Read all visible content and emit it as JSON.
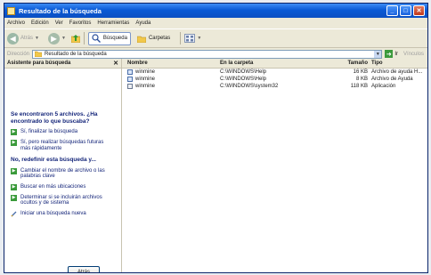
{
  "window": {
    "title": "Resultado de la búsqueda",
    "minimize": "_",
    "maximize": "□"
  },
  "menu": [
    "Archivo",
    "Edición",
    "Ver",
    "Favoritos",
    "Herramientas",
    "Ayuda"
  ],
  "toolbar": {
    "back_label": "Atrás",
    "search_label": "Búsqueda",
    "folders_label": "Carpetas"
  },
  "address": {
    "label": "Dirección",
    "value": "Resultado de la búsqueda",
    "go_label": "Ir",
    "links_label": "Vínculos"
  },
  "sidebar": {
    "title": "Asistente para búsqueda",
    "found_text": "Se encontraron 5 archivos. ¿Ha encontrado lo que buscaba?",
    "options_found": [
      "Sí, finalizar la búsqueda",
      "Sí, pero realizar búsquedas futuras más rápidamente"
    ],
    "redefine_text": "No, redefinir esta búsqueda y...",
    "options_redefine": [
      "Cambiar el nombre de archivo o las palabras clave",
      "Buscar en más ubicaciones",
      "Determinar si se incluirán archivos ocultos y de sistema"
    ],
    "new_search": "Iniciar una búsqueda nueva",
    "back_button": "Atrás"
  },
  "results": {
    "columns": {
      "name": "Nombre",
      "folder": "En la carpeta",
      "size": "Tamaño",
      "type": "Tipo"
    },
    "rows": [
      {
        "name": "winmine",
        "folder": "C:\\WINDOWS\\Help",
        "size": "16 KB",
        "type": "Archivo de ayuda H..."
      },
      {
        "name": "winmine",
        "folder": "C:\\WINDOWS\\Help",
        "size": "8 KB",
        "type": "Archivo de Ayuda"
      },
      {
        "name": "winmine",
        "folder": "C:\\WINDOWS\\system32",
        "size": "118 KB",
        "type": "Aplicación"
      }
    ]
  }
}
